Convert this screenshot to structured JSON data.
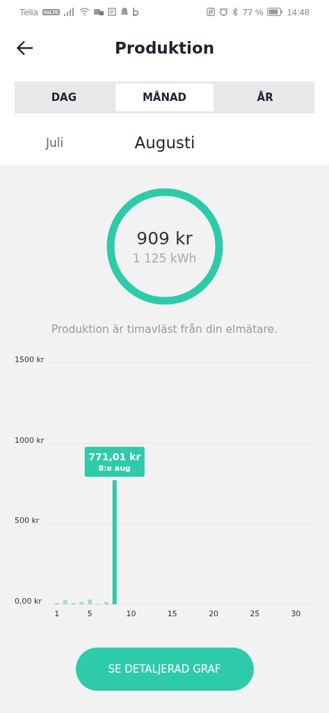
{
  "status_bar": {
    "carrier": "Telia",
    "network_badge": "VoLTE",
    "battery": "77 %",
    "time": "14:48"
  },
  "header": {
    "title": "Produktion"
  },
  "tabs": [
    {
      "label": "DAG",
      "selected": false
    },
    {
      "label": "MÅNAD",
      "selected": true
    },
    {
      "label": "ÅR",
      "selected": false
    }
  ],
  "period": {
    "previous": "Juli",
    "current": "Augusti"
  },
  "summary": {
    "amount": "909 kr",
    "energy": "1 125 kWh"
  },
  "note": "Produktion är timavläst från din elmätare.",
  "chart": {
    "tooltip": {
      "value": "771,01 kr",
      "date": "8:e aug"
    },
    "chart_data": {
      "type": "bar",
      "x": [
        1,
        2,
        3,
        4,
        5,
        6,
        7,
        8
      ],
      "series": [
        {
          "color": "#2ecbaa",
          "values": [
            8,
            28,
            8,
            15,
            30,
            2,
            15,
            771
          ]
        }
      ],
      "xlim": [
        0,
        32.5
      ],
      "ylim": [
        0,
        1500
      ],
      "yticks": [
        {
          "value": 0,
          "label": "0,00 kr"
        },
        {
          "value": 500,
          "label": "500 kr"
        },
        {
          "value": 1000,
          "label": "1000 kr"
        },
        {
          "value": 1500,
          "label": "1500 kr"
        }
      ],
      "xticks": [
        1,
        5,
        10,
        15,
        20,
        25,
        30
      ]
    }
  },
  "button": "SE DETALJERAD GRAF"
}
